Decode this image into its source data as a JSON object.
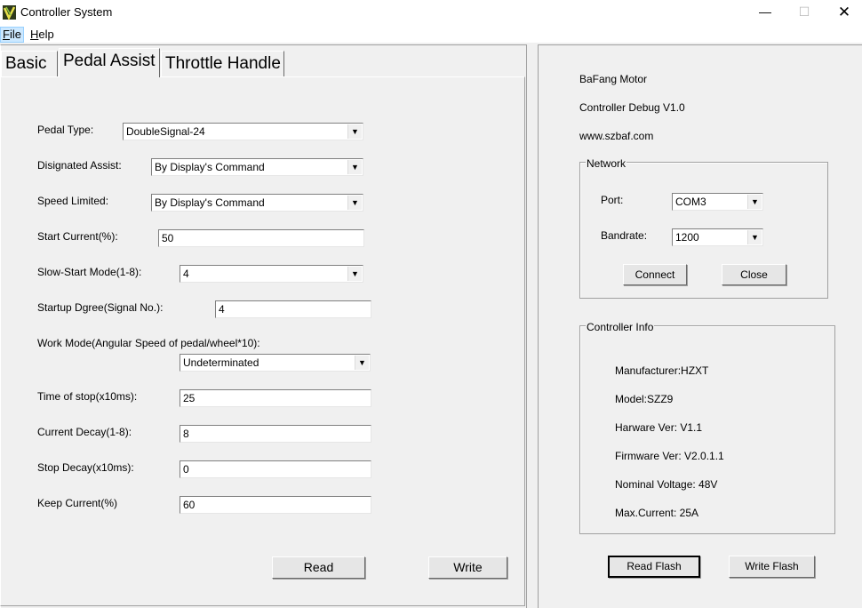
{
  "window": {
    "title": "Controller System",
    "minimize": "—",
    "maximize": "☐",
    "close": "✕"
  },
  "menu": {
    "file_hotkey": "F",
    "file_rest": "ile",
    "help_hotkey": "H",
    "help_rest": "elp"
  },
  "tabs": {
    "basic": "Basic",
    "pedal_assist": "Pedal Assist",
    "throttle_handle": "Throttle Handle",
    "active": "Pedal Assist"
  },
  "pedal_form": {
    "pedal_type": {
      "label": "Pedal Type:",
      "value": "DoubleSignal-24"
    },
    "designated_assist": {
      "label": "Disignated Assist:",
      "value": "By Display's Command"
    },
    "speed_limited": {
      "label": "Speed Limited:",
      "value": "By Display's Command"
    },
    "start_current": {
      "label": "Start Current(%):",
      "value": "50"
    },
    "slow_start_mode": {
      "label": "Slow-Start Mode(1-8):",
      "value": "4"
    },
    "startup_degree": {
      "label": "Startup Dgree(Signal No.):",
      "value": "4"
    },
    "work_mode": {
      "label": "Work Mode(Angular Speed of pedal/wheel*10):",
      "value": "Undeterminated"
    },
    "time_of_stop": {
      "label": "Time of stop(x10ms):",
      "value": "25"
    },
    "current_decay": {
      "label": "Current Decay(1-8):",
      "value": "8"
    },
    "stop_decay": {
      "label": "Stop Decay(x10ms):",
      "value": "0"
    },
    "keep_current": {
      "label": "Keep Current(%)",
      "value": "60"
    },
    "read_button": "Read",
    "write_button": "Write",
    "dropdown_arrow": "▼"
  },
  "about": {
    "line1": "BaFang Motor",
    "line2": "Controller Debug V1.0",
    "line3": "www.szbaf.com"
  },
  "network": {
    "title": "Network",
    "port_label": "Port:",
    "port_value": "COM3",
    "baudrate_label": "Bandrate:",
    "baudrate_value": "1200",
    "connect_button": "Connect",
    "close_button": "Close"
  },
  "controller_info": {
    "title": "Controller Info",
    "manufacturer": "Manufacturer:HZXT",
    "model": "Model:SZZ9",
    "hardware_ver": "Harware Ver: V1.1",
    "firmware_ver": "Firmware Ver: V2.0.1.1",
    "nominal_voltage": "Nominal Voltage: 48V",
    "max_current": "Max.Current: 25A"
  },
  "flash": {
    "read_button": "Read Flash",
    "write_button": "Write Flash"
  }
}
